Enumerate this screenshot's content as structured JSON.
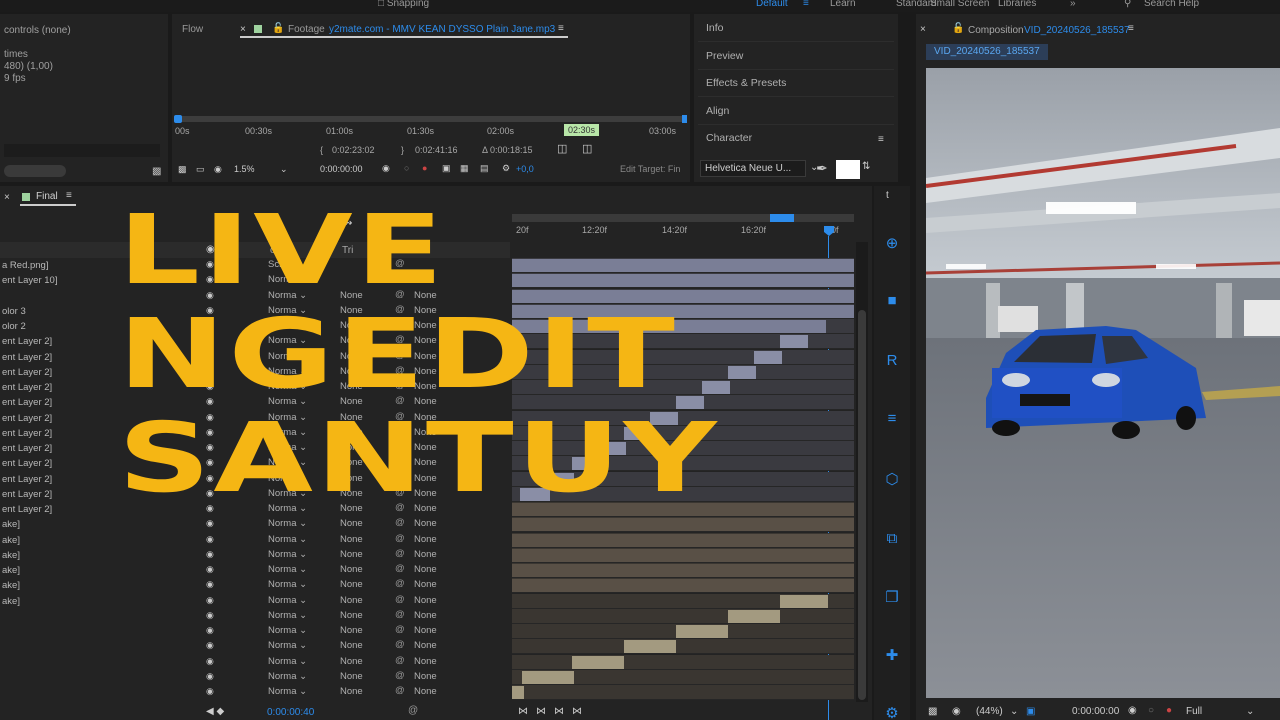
{
  "menubar": {
    "snapping": "Snapping",
    "workspaces": [
      "Default",
      "Learn",
      "Standard",
      "Small Screen",
      "Libraries"
    ],
    "active_workspace": "Default",
    "search_help": "Search Help"
  },
  "project_panel": {
    "lines": [
      "controls (none)",
      "times",
      "480) (1,00)",
      "9 fps"
    ]
  },
  "footage_panel": {
    "flow_tab": "Flow",
    "footage_tab_prefix": "Footage",
    "footage_name": "y2mate.com - MMV  KEAN DYSSO  Plain Jane.mp3",
    "ruler": [
      "00s",
      "00:30s",
      "01:00s",
      "01:30s",
      "02:00s",
      "02:30s",
      "03:00s"
    ],
    "in_point": "0:02:23:02",
    "out_point": "0:02:41:16",
    "duration": "Δ 0:00:18:15",
    "zoom": "1.5%",
    "timecode": "0:00:00:00",
    "offset": "+0,0",
    "edit_target": "Edit Target: Fin"
  },
  "side_panels": {
    "items": [
      "Info",
      "Preview",
      "Effects & Presets",
      "Align",
      "Character"
    ],
    "font": "Helvetica Neue U..."
  },
  "timeline": {
    "tab": "Final",
    "ruler": [
      "20f",
      "12:20f",
      "14:20f",
      "16:20f",
      "20f"
    ],
    "header_labels": [
      "ode",
      "Tri",
      "Parent"
    ],
    "current_time": "0:00:00:40",
    "rows": [
      {
        "name": "a Red.png]",
        "mode": "Screen",
        "trk": "",
        "parent": ""
      },
      {
        "name": "ent Layer 10]",
        "mode": "Norma",
        "trk": "",
        "parent": ""
      },
      {
        "name": "",
        "mode": "Norma",
        "trk": "None",
        "parent": "None"
      },
      {
        "name": "olor 3",
        "mode": "Norma",
        "trk": "None",
        "parent": "None"
      },
      {
        "name": "olor 2",
        "mode": "Norma",
        "trk": "None",
        "parent": "None"
      },
      {
        "name": "ent Layer 2]",
        "mode": "Norma",
        "trk": "None",
        "parent": "None"
      },
      {
        "name": "ent Layer 2]",
        "mode": "Norma",
        "trk": "None",
        "parent": "None"
      },
      {
        "name": "ent Layer 2]",
        "mode": "Norma",
        "trk": "None",
        "parent": "None"
      },
      {
        "name": "ent Layer 2]",
        "mode": "Norma",
        "trk": "None",
        "parent": "None"
      },
      {
        "name": "ent Layer 2]",
        "mode": "Norma",
        "trk": "None",
        "parent": "None"
      },
      {
        "name": "ent Layer 2]",
        "mode": "Norma",
        "trk": "None",
        "parent": "None"
      },
      {
        "name": "ent Layer 2]",
        "mode": "Norma",
        "trk": "None",
        "parent": "None"
      },
      {
        "name": "ent Layer 2]",
        "mode": "Norma",
        "trk": "None",
        "parent": "None"
      },
      {
        "name": "ent Layer 2]",
        "mode": "Norma",
        "trk": "None",
        "parent": "None"
      },
      {
        "name": "ent Layer 2]",
        "mode": "Norma",
        "trk": "None",
        "parent": "None"
      },
      {
        "name": "ent Layer 2]",
        "mode": "Norma",
        "trk": "None",
        "parent": "None"
      },
      {
        "name": "ent Layer 2]",
        "mode": "Norma",
        "trk": "None",
        "parent": "None"
      },
      {
        "name": "ake]",
        "mode": "Norma",
        "trk": "None",
        "parent": "None"
      },
      {
        "name": "ake]",
        "mode": "Norma",
        "trk": "None",
        "parent": "None"
      },
      {
        "name": "ake]",
        "mode": "Norma",
        "trk": "None",
        "parent": "None"
      },
      {
        "name": "ake]",
        "mode": "Norma",
        "trk": "None",
        "parent": "None"
      },
      {
        "name": "ake]",
        "mode": "Norma",
        "trk": "None",
        "parent": "None"
      },
      {
        "name": "ake]",
        "mode": "Norma",
        "trk": "None",
        "parent": "None"
      },
      {
        "name": "",
        "mode": "Norma",
        "trk": "None",
        "parent": "None"
      },
      {
        "name": "",
        "mode": "Norma",
        "trk": "None",
        "parent": "None"
      },
      {
        "name": "",
        "mode": "Norma",
        "trk": "None",
        "parent": "None"
      },
      {
        "name": "",
        "mode": "Norma",
        "trk": "None",
        "parent": "None"
      },
      {
        "name": "",
        "mode": "Norma",
        "trk": "None",
        "parent": "None"
      },
      {
        "name": "",
        "mode": "Norma",
        "trk": "None",
        "parent": "None"
      }
    ]
  },
  "composition": {
    "tab_prefix": "Composition",
    "name": "VID_20240526_185537",
    "subtab": "VID_20240526_185537",
    "zoom": "(44%)",
    "timecode": "0:00:00:00",
    "resolution": "Full"
  },
  "overlay": {
    "line1": "LIVE",
    "line2": "NGEDIT",
    "line3": "SANTUY"
  },
  "colors": {
    "accent_blue": "#2d8ceb",
    "overlay_yellow": "#f5b614",
    "panel_bg": "#232323"
  }
}
